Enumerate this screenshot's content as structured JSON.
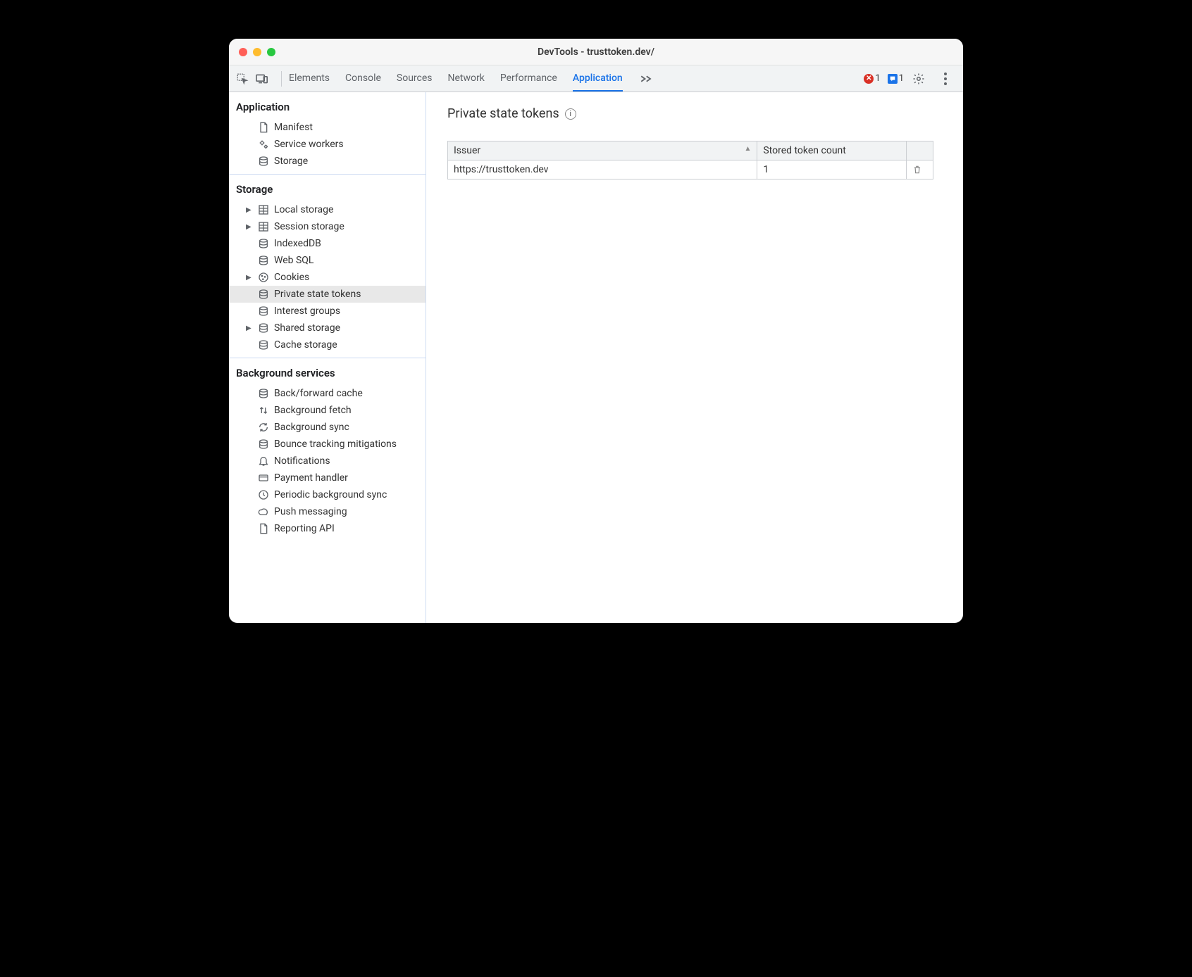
{
  "window": {
    "title": "DevTools - trusttoken.dev/"
  },
  "toolbar": {
    "tabs": [
      "Elements",
      "Console",
      "Sources",
      "Network",
      "Performance",
      "Application"
    ],
    "active_tab": "Application",
    "error_count": "1",
    "message_count": "1"
  },
  "sidebar": {
    "sections": [
      {
        "title": "Application",
        "items": [
          {
            "label": "Manifest",
            "icon": "file",
            "expandable": false
          },
          {
            "label": "Service workers",
            "icon": "gears",
            "expandable": false
          },
          {
            "label": "Storage",
            "icon": "db",
            "expandable": false
          }
        ]
      },
      {
        "title": "Storage",
        "items": [
          {
            "label": "Local storage",
            "icon": "grid",
            "expandable": true
          },
          {
            "label": "Session storage",
            "icon": "grid",
            "expandable": true
          },
          {
            "label": "IndexedDB",
            "icon": "db",
            "expandable": false
          },
          {
            "label": "Web SQL",
            "icon": "db",
            "expandable": false
          },
          {
            "label": "Cookies",
            "icon": "cookie",
            "expandable": true
          },
          {
            "label": "Private state tokens",
            "icon": "db",
            "expandable": false,
            "selected": true
          },
          {
            "label": "Interest groups",
            "icon": "db",
            "expandable": false
          },
          {
            "label": "Shared storage",
            "icon": "db",
            "expandable": true
          },
          {
            "label": "Cache storage",
            "icon": "db",
            "expandable": false
          }
        ]
      },
      {
        "title": "Background services",
        "items": [
          {
            "label": "Back/forward cache",
            "icon": "db",
            "expandable": false
          },
          {
            "label": "Background fetch",
            "icon": "updown",
            "expandable": false
          },
          {
            "label": "Background sync",
            "icon": "sync",
            "expandable": false
          },
          {
            "label": "Bounce tracking mitigations",
            "icon": "db",
            "expandable": false
          },
          {
            "label": "Notifications",
            "icon": "bell",
            "expandable": false
          },
          {
            "label": "Payment handler",
            "icon": "card",
            "expandable": false
          },
          {
            "label": "Periodic background sync",
            "icon": "clock",
            "expandable": false
          },
          {
            "label": "Push messaging",
            "icon": "cloud",
            "expandable": false
          },
          {
            "label": "Reporting API",
            "icon": "file",
            "expandable": false
          }
        ]
      }
    ]
  },
  "main": {
    "title": "Private state tokens",
    "table": {
      "headers": [
        "Issuer",
        "Stored token count"
      ],
      "rows": [
        {
          "issuer": "https://trusttoken.dev",
          "count": "1"
        }
      ]
    }
  }
}
